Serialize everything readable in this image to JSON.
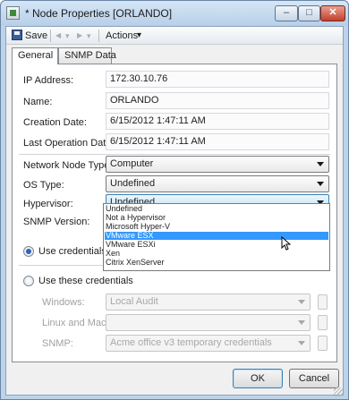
{
  "window": {
    "title": "* Node Properties [ORLANDO]",
    "controls": {
      "minimize": "–",
      "maximize": "□",
      "close": "✕"
    }
  },
  "toolbar": {
    "save_label": "Save",
    "nav_back_glyph": "◀",
    "nav_forward_glyph": "▶",
    "actions_label": "Actions",
    "dropdown_glyph": "▾"
  },
  "tabs": [
    {
      "label": "General",
      "active": true
    },
    {
      "label": "SNMP Data",
      "active": false
    }
  ],
  "general": {
    "ip_label": "IP Address:",
    "ip_value": "172.30.10.76",
    "name_label": "Name:",
    "name_value": "ORLANDO",
    "creation_label": "Creation Date:",
    "creation_value": "6/15/2012 1:47:11 AM",
    "lastop_label": "Last Operation Date:",
    "lastop_value": "6/15/2012 1:47:11 AM",
    "network_node_type_label": "Network Node Type:",
    "network_node_type_value": "Computer",
    "os_type_label": "OS Type:",
    "os_type_value": "Undefined",
    "hypervisor_label": "Hypervisor:",
    "hypervisor_value": "Undefined",
    "snmp_version_label": "SNMP Version:",
    "radio_use_from": "Use credentials from",
    "radio_use_these": "Use these credentials",
    "windows_label": "Windows:",
    "windows_value": "Local Audit",
    "linux_mac_label": "Linux and Mac:",
    "linux_mac_value": "",
    "snmp_label": "SNMP:",
    "snmp_value": "Acme office v3 temporary credentials"
  },
  "hypervisor_options": [
    "Undefined",
    "Not a Hypervisor",
    "Microsoft Hyper-V",
    "VMware ESX",
    "VMware ESXi",
    "Xen",
    "Citrix XenServer"
  ],
  "hypervisor_highlighted": "VMware ESX",
  "buttons": {
    "ok": "OK",
    "cancel": "Cancel"
  },
  "colors": {
    "selection": "#3399ff",
    "focus_border": "#3c7fb1",
    "title_bar": "#bcd3ea"
  }
}
